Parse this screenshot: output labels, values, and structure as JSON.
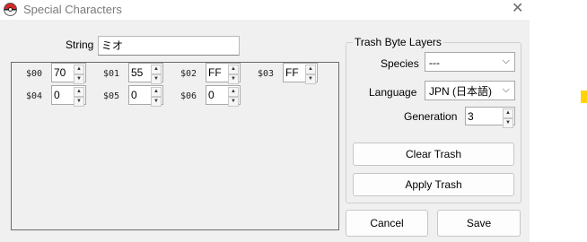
{
  "window": {
    "title": "Special Characters"
  },
  "string_field": {
    "label": "String",
    "value": "ミオ"
  },
  "bytes": [
    {
      "label": "$00",
      "value": "70"
    },
    {
      "label": "$01",
      "value": "55"
    },
    {
      "label": "$02",
      "value": "FF"
    },
    {
      "label": "$03",
      "value": "FF"
    },
    {
      "label": "$04",
      "value": "0"
    },
    {
      "label": "$05",
      "value": "0"
    },
    {
      "label": "$06",
      "value": "0"
    }
  ],
  "trash_layers": {
    "title": "Trash Byte Layers",
    "species_label": "Species",
    "species_value": "---",
    "language_label": "Language",
    "language_value": "JPN (日本語)",
    "generation_label": "Generation",
    "generation_value": "3",
    "clear_label": "Clear Trash",
    "apply_label": "Apply Trash"
  },
  "actions": {
    "cancel_label": "Cancel",
    "save_label": "Save"
  },
  "icons": {
    "app": "pokeball-icon",
    "close": "close-icon",
    "up": "up-arrow-icon",
    "down": "down-arrow-icon",
    "chevron": "chevron-down-icon"
  }
}
